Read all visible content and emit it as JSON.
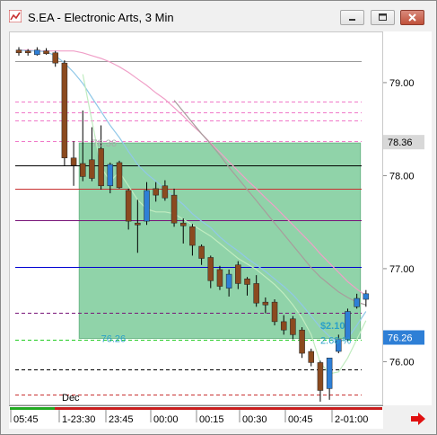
{
  "window": {
    "title": "S.EA - Electronic Arts, 3 Min",
    "buttons": [
      "minimize",
      "maximize",
      "close"
    ]
  },
  "chart_data": {
    "type": "candlestick",
    "title": "S.EA - Electronic Arts, 3 Min",
    "y_ticks": [
      "79.00",
      "78.00",
      "77.00",
      "76.00"
    ],
    "y_tick_values": [
      79.0,
      78.0,
      77.0,
      76.0
    ],
    "ylim": [
      75.55,
      79.55
    ],
    "price_tags": [
      {
        "label": "78.36",
        "value": 78.36,
        "bg": "#d8d8d8",
        "color": "#000000"
      },
      {
        "label": "76.26",
        "value": 76.26,
        "bg": "#2e7fd6",
        "color": "#ffffff"
      }
    ],
    "x_labels": [
      "05:45",
      "1-23:30",
      "23:45",
      "00:00",
      "00:15",
      "00:30",
      "00:45",
      "2-01:00"
    ],
    "date_label": "Dec",
    "candles": [
      {
        "o": 79.36,
        "h": 79.39,
        "l": 79.3,
        "c": 79.33
      },
      {
        "o": 79.35,
        "h": 79.37,
        "l": 79.3,
        "c": 79.33
      },
      {
        "o": 79.31,
        "h": 79.39,
        "l": 79.3,
        "c": 79.36
      },
      {
        "o": 79.35,
        "h": 79.38,
        "l": 79.31,
        "c": 79.32
      },
      {
        "o": 79.33,
        "h": 79.35,
        "l": 79.18,
        "c": 79.22
      },
      {
        "o": 79.22,
        "h": 79.25,
        "l": 78.12,
        "c": 78.2
      },
      {
        "o": 78.2,
        "h": 78.38,
        "l": 77.9,
        "c": 78.12
      },
      {
        "o": 78.14,
        "h": 78.71,
        "l": 77.95,
        "c": 78.0
      },
      {
        "o": 78.18,
        "h": 78.53,
        "l": 77.95,
        "c": 77.98
      },
      {
        "o": 78.3,
        "h": 78.55,
        "l": 77.86,
        "c": 77.9
      },
      {
        "o": 77.9,
        "h": 78.15,
        "l": 77.82,
        "c": 78.13
      },
      {
        "o": 78.15,
        "h": 78.17,
        "l": 77.87,
        "c": 77.88
      },
      {
        "o": 77.85,
        "h": 77.87,
        "l": 77.43,
        "c": 77.52
      },
      {
        "o": 77.5,
        "h": 77.75,
        "l": 77.18,
        "c": 77.48
      },
      {
        "o": 77.52,
        "h": 77.94,
        "l": 77.48,
        "c": 77.85
      },
      {
        "o": 77.87,
        "h": 77.94,
        "l": 77.73,
        "c": 77.8
      },
      {
        "o": 77.9,
        "h": 77.96,
        "l": 77.74,
        "c": 77.77
      },
      {
        "o": 77.8,
        "h": 77.87,
        "l": 77.46,
        "c": 77.5
      },
      {
        "o": 77.5,
        "h": 77.55,
        "l": 77.28,
        "c": 77.47
      },
      {
        "o": 77.46,
        "h": 77.49,
        "l": 77.15,
        "c": 77.26
      },
      {
        "o": 77.25,
        "h": 77.27,
        "l": 77.05,
        "c": 77.12
      },
      {
        "o": 77.13,
        "h": 77.15,
        "l": 76.8,
        "c": 76.88
      },
      {
        "o": 77.0,
        "h": 77.04,
        "l": 76.78,
        "c": 76.82
      },
      {
        "o": 76.8,
        "h": 77.0,
        "l": 76.71,
        "c": 76.95
      },
      {
        "o": 77.05,
        "h": 77.09,
        "l": 76.79,
        "c": 76.85
      },
      {
        "o": 76.9,
        "h": 76.92,
        "l": 76.72,
        "c": 76.84
      },
      {
        "o": 76.85,
        "h": 76.94,
        "l": 76.6,
        "c": 76.64
      },
      {
        "o": 76.65,
        "h": 76.7,
        "l": 76.53,
        "c": 76.62
      },
      {
        "o": 76.65,
        "h": 76.68,
        "l": 76.4,
        "c": 76.44
      },
      {
        "o": 76.44,
        "h": 76.51,
        "l": 76.3,
        "c": 76.35
      },
      {
        "o": 76.47,
        "h": 76.5,
        "l": 76.25,
        "c": 76.3
      },
      {
        "o": 76.35,
        "h": 76.38,
        "l": 76.05,
        "c": 76.1
      },
      {
        "o": 76.12,
        "h": 76.15,
        "l": 75.96,
        "c": 76.0
      },
      {
        "o": 76.0,
        "h": 76.02,
        "l": 75.58,
        "c": 75.7
      },
      {
        "o": 75.72,
        "h": 76.05,
        "l": 75.6,
        "c": 76.05
      },
      {
        "o": 76.12,
        "h": 76.3,
        "l": 76.1,
        "c": 76.25
      },
      {
        "o": 76.25,
        "h": 76.58,
        "l": 76.23,
        "c": 76.55
      },
      {
        "o": 76.6,
        "h": 76.74,
        "l": 76.58,
        "c": 76.69
      },
      {
        "o": 76.68,
        "h": 76.78,
        "l": 76.6,
        "c": 76.74
      }
    ],
    "horizontal_lines": [
      {
        "value": 79.24,
        "color": "#9a9a9a",
        "style": "solid"
      },
      {
        "value": 78.81,
        "color": "#f078c8",
        "style": "dashed"
      },
      {
        "value": 78.69,
        "color": "#f078c8",
        "style": "dashed"
      },
      {
        "value": 78.6,
        "color": "#f078c8",
        "style": "dashed"
      },
      {
        "value": 78.38,
        "color": "#f078c8",
        "style": "dashed"
      },
      {
        "value": 78.12,
        "color": "#000000",
        "style": "solid"
      },
      {
        "value": 77.87,
        "color": "#c83232",
        "style": "solid"
      },
      {
        "value": 77.53,
        "color": "#781478",
        "style": "solid"
      },
      {
        "value": 77.03,
        "color": "#0000d2",
        "style": "solid"
      },
      {
        "value": 76.54,
        "color": "#781478",
        "style": "dashed"
      },
      {
        "value": 76.25,
        "color": "#22cc22",
        "style": "dashed"
      },
      {
        "value": 75.93,
        "color": "#000000",
        "style": "dashed"
      },
      {
        "value": 75.66,
        "color": "#c83232",
        "style": "dashed"
      }
    ],
    "moving_averages": [
      {
        "color": "#f0a0c8",
        "values": [
          79.36,
          79.36,
          79.35,
          79.35,
          79.35,
          79.35,
          79.35,
          79.33,
          79.3,
          79.27,
          79.23,
          79.18,
          79.12,
          79.05,
          78.98,
          78.9,
          78.83,
          78.74,
          78.65,
          78.55,
          78.46,
          78.36,
          78.26,
          78.16,
          78.06,
          77.96,
          77.87,
          77.77,
          77.68,
          77.58,
          77.48,
          77.38,
          77.28,
          77.17,
          77.07,
          76.97,
          76.87,
          76.79,
          76.72
        ]
      },
      {
        "color": "#a89c9c",
        "values": [
          null,
          null,
          null,
          null,
          null,
          null,
          null,
          null,
          null,
          null,
          null,
          null,
          null,
          null,
          null,
          null,
          null,
          78.82,
          78.7,
          78.58,
          78.46,
          78.35,
          78.23,
          78.1,
          77.98,
          77.86,
          77.74,
          77.62,
          77.5,
          77.38,
          77.26,
          77.14,
          77.02,
          76.92,
          76.84,
          76.76,
          76.7,
          76.65,
          76.62
        ]
      },
      {
        "color": "#90c8e8",
        "values": [
          79.36,
          79.35,
          79.35,
          79.34,
          79.3,
          79.22,
          79.12,
          79.0,
          78.85,
          78.7,
          78.55,
          78.42,
          78.27,
          78.13,
          78.03,
          77.95,
          77.87,
          77.78,
          77.7,
          77.6,
          77.52,
          77.45,
          77.35,
          77.27,
          77.2,
          77.12,
          77.05,
          76.98,
          76.9,
          76.82,
          76.73,
          76.62,
          76.5,
          76.38,
          76.28,
          76.22,
          76.26,
          76.4,
          76.55
        ]
      },
      {
        "color": "#c0ecc0",
        "values": [
          null,
          null,
          null,
          null,
          null,
          null,
          null,
          79.1,
          78.6,
          78.1,
          77.95,
          78.05,
          77.9,
          77.75,
          77.65,
          77.62,
          77.62,
          77.6,
          77.54,
          77.48,
          77.42,
          77.36,
          77.28,
          77.2,
          77.12,
          77.06,
          77.0,
          76.92,
          76.84,
          76.74,
          76.62,
          76.48,
          76.3,
          76.0,
          75.88,
          75.9,
          76.05,
          76.25,
          76.45
        ]
      }
    ],
    "box": {
      "top_value": 78.36,
      "bottom_value": 76.26,
      "start_index": 7,
      "end_index": 37,
      "fill": "#7ccb9a"
    },
    "annotations": [
      {
        "text": "78.36",
        "value": 78.36,
        "index": 8,
        "color": "#a8a8a8"
      },
      {
        "text": "76.26",
        "value": 76.26,
        "index": 9,
        "color": "#2aa0c8"
      },
      {
        "text": "$2.10",
        "value": 76.4,
        "index": 33,
        "color": "#2aa0c8"
      },
      {
        "text": "2.68 %",
        "value": 76.24,
        "index": 33,
        "color": "#2aa0c8"
      }
    ],
    "colors": {
      "up": "#2e7fd6",
      "down": "#8b4a1f"
    }
  }
}
